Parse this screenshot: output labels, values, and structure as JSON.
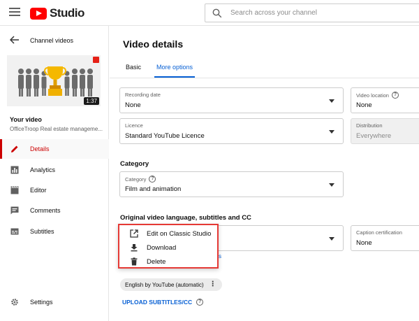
{
  "header": {
    "logo_text": "Studio",
    "search_placeholder": "Search across your channel"
  },
  "sidebar": {
    "back_label": "Channel videos",
    "thumbnail_duration": "1:37",
    "your_video_label": "Your video",
    "video_subtitle": "OfficeTroop Real estate manageme...",
    "nav": [
      {
        "label": "Details",
        "icon": "pencil-icon",
        "active": true
      },
      {
        "label": "Analytics",
        "icon": "analytics-icon",
        "active": false
      },
      {
        "label": "Editor",
        "icon": "clapperboard-icon",
        "active": false
      },
      {
        "label": "Comments",
        "icon": "comment-icon",
        "active": false
      },
      {
        "label": "Subtitles",
        "icon": "subtitles-icon",
        "active": false
      },
      {
        "label": "Settings",
        "icon": "gear-icon",
        "active": false
      }
    ]
  },
  "main": {
    "title": "Video details",
    "tabs": [
      {
        "label": "Basic",
        "active": false
      },
      {
        "label": "More options",
        "active": true
      }
    ],
    "recording_date": {
      "label": "Recording date",
      "value": "None"
    },
    "video_location": {
      "label": "Video location",
      "value": "None"
    },
    "licence": {
      "label": "Licence",
      "value": "Standard YouTube Licence"
    },
    "distribution": {
      "label": "Distribution",
      "value": "Everywhere"
    },
    "category_section": "Category",
    "category": {
      "label": "Category",
      "value": "Film and animation"
    },
    "language_section": "Original video language, subtitles and CC",
    "caption_certification": {
      "label": "Caption certification",
      "value": "None"
    },
    "subtitle_chip": "English by YouTube (automatic)",
    "upload_link": "UPLOAD SUBTITLES/CC"
  },
  "context_menu": {
    "items": [
      {
        "label": "Edit on Classic Studio",
        "icon": "open-external-icon"
      },
      {
        "label": "Download",
        "icon": "download-icon"
      },
      {
        "label": "Delete",
        "icon": "trash-icon"
      }
    ]
  },
  "colors": {
    "accent_blue": "#065fd4",
    "active_red": "#cc0000",
    "highlight_border": "#e53935"
  }
}
